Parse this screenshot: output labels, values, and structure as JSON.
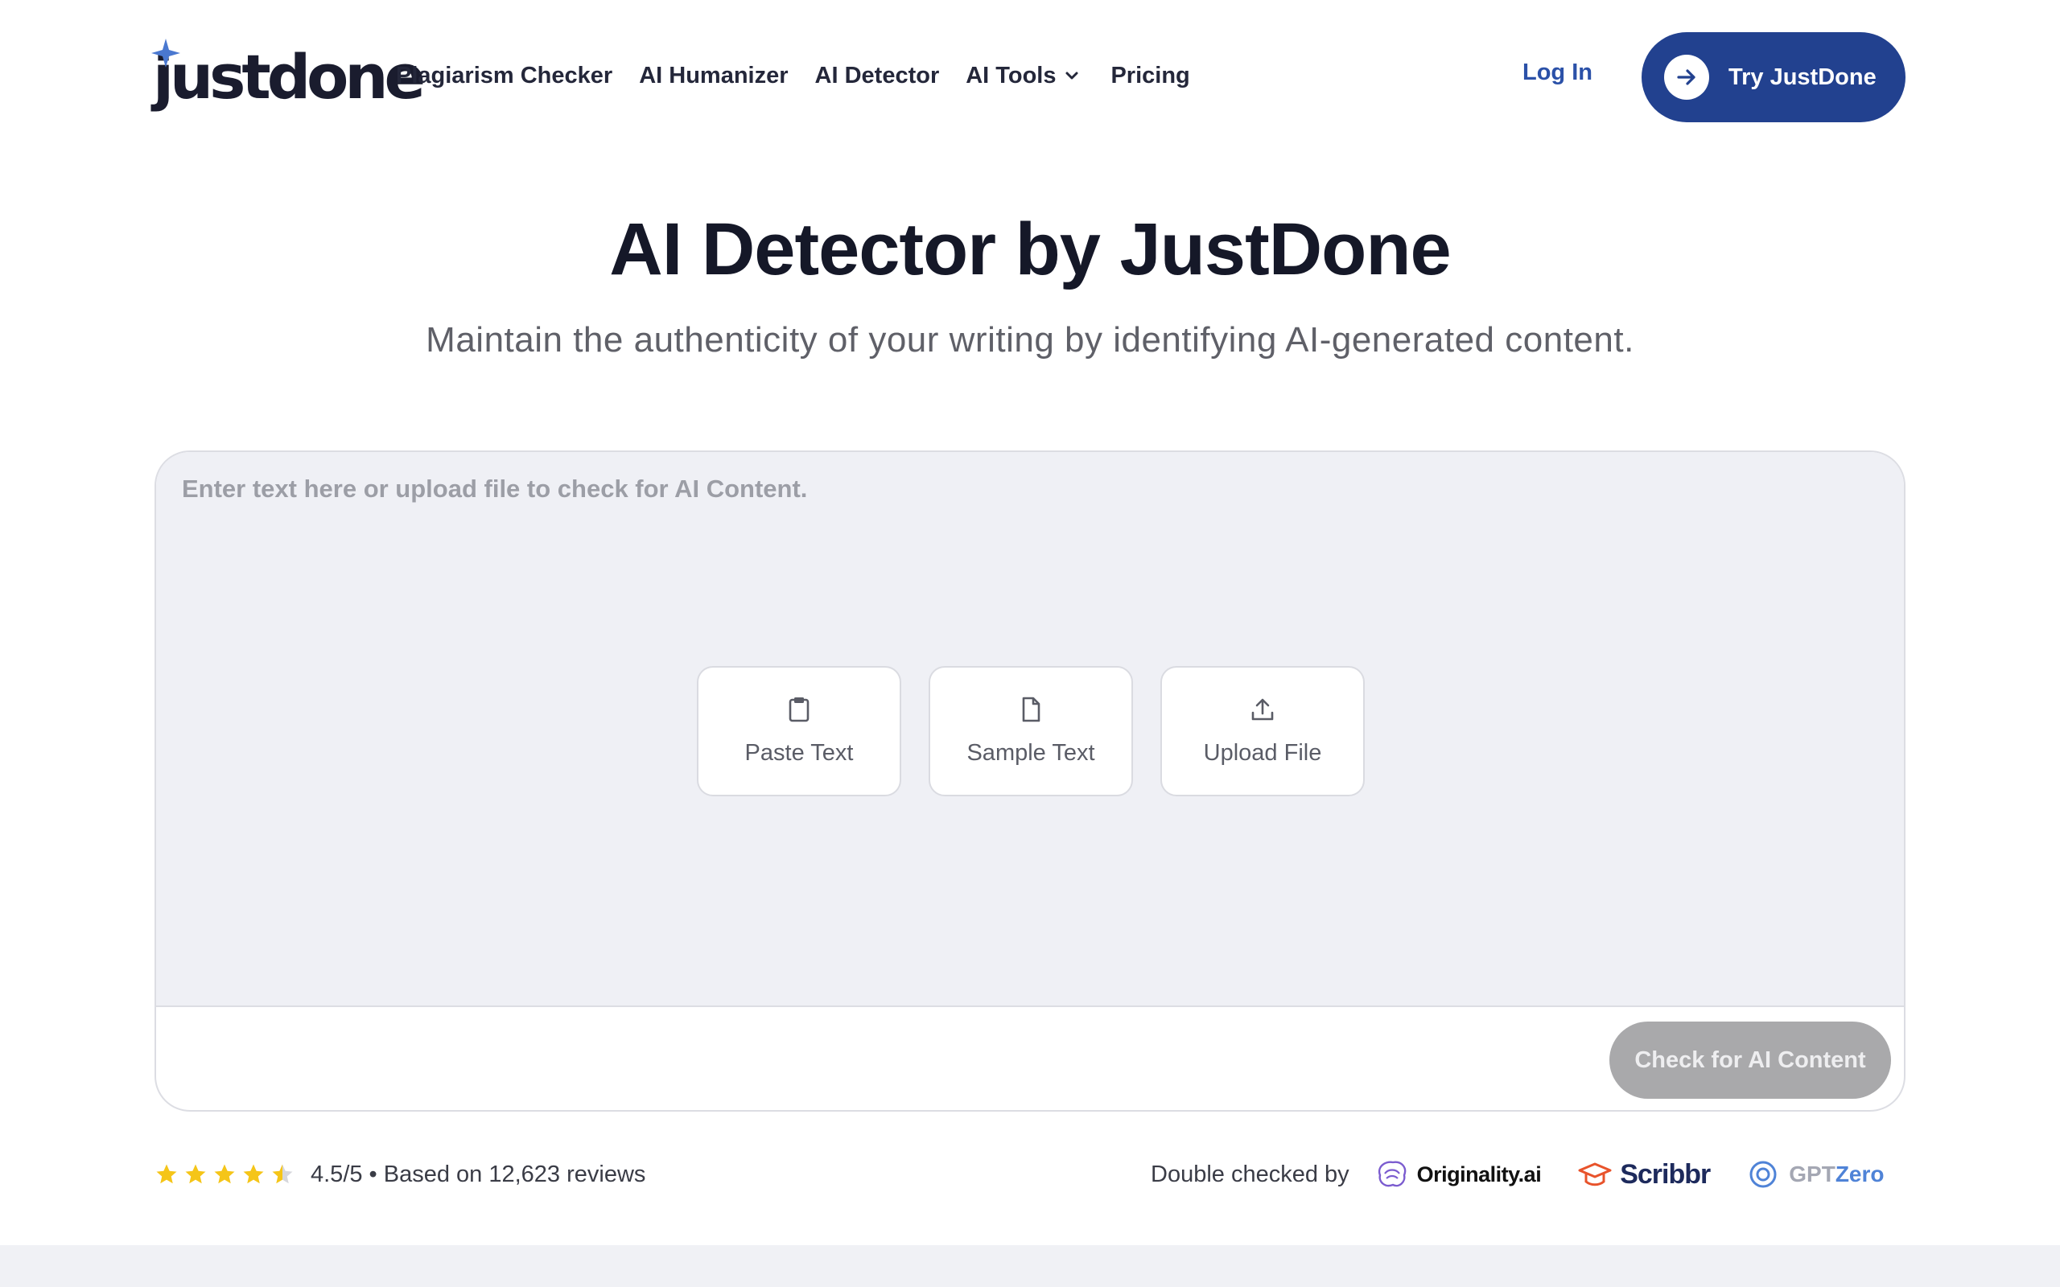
{
  "header": {
    "logo": "justdone",
    "nav": [
      {
        "label": "Plagiarism Checker"
      },
      {
        "label": "AI Humanizer"
      },
      {
        "label": "AI Detector"
      },
      {
        "label": "AI Tools",
        "icon": "chevron-down-icon"
      },
      {
        "label": "Pricing"
      }
    ],
    "login_label": "Log In",
    "cta_label": "Try JustDone",
    "cta_icon": "arrow-right-icon"
  },
  "hero": {
    "title": "AI Detector by JustDone",
    "subtitle": "Maintain the authenticity of your writing by identifying AI-generated content."
  },
  "editor": {
    "placeholder": "Enter text here or upload file to check for AI Content.",
    "value": "",
    "actions": [
      {
        "label": "Paste Text",
        "icon": "clipboard-icon"
      },
      {
        "label": "Sample Text",
        "icon": "document-icon"
      },
      {
        "label": "Upload File",
        "icon": "upload-icon"
      }
    ],
    "submit_label": "Check for AI Content"
  },
  "rating": {
    "stars": 4.5,
    "text": "4.5/5 • Based on 12,623 reviews"
  },
  "checked_by": {
    "label": "Double checked by",
    "partners": {
      "originality": "Originality.ai",
      "scribbr": "Scribbr",
      "gptzero_a": "GPT",
      "gptzero_b": "Zero"
    }
  },
  "colors": {
    "brand": "#22418f",
    "link": "#2b51a8",
    "editor_bg": "#eff0f5",
    "disabled_button": "#a9a9ab",
    "star": "#f5c518"
  }
}
